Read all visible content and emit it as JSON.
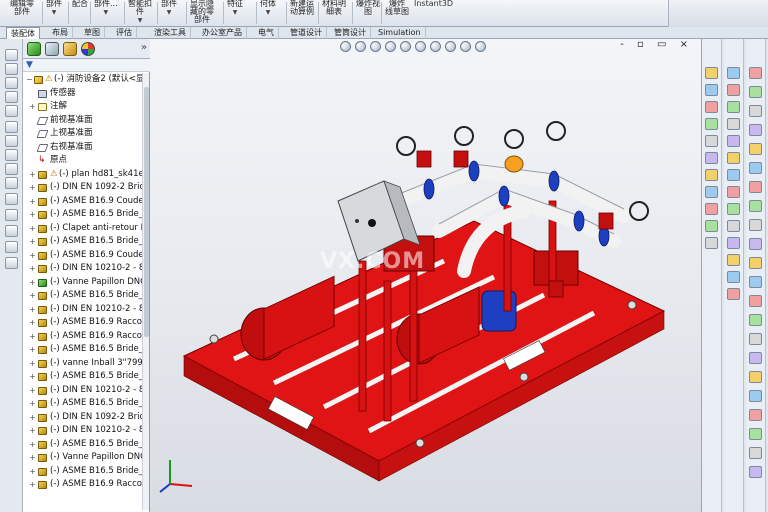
{
  "ribbon": {
    "buttons": [
      {
        "label": "编辑零\n部件",
        "has_dropdown": false
      },
      {
        "label": "部件",
        "has_dropdown": true
      },
      {
        "label": "配合",
        "has_dropdown": false
      },
      {
        "label": "部件...",
        "has_dropdown": true
      },
      {
        "label": "智能扣\n件",
        "has_dropdown": true
      },
      {
        "label": "部件",
        "has_dropdown": true
      },
      {
        "label": "显示隐\n藏的零\n部件",
        "has_dropdown": false
      },
      {
        "label": "特征",
        "has_dropdown": true
      },
      {
        "label": "何体",
        "has_dropdown": true
      },
      {
        "label": "新建运\n动算例",
        "has_dropdown": false
      },
      {
        "label": "材料明\n细表",
        "has_dropdown": false
      },
      {
        "label": "爆炸视\n图",
        "has_dropdown": false
      },
      {
        "label": "爆炸\n线草图",
        "has_dropdown": false
      }
    ],
    "instant3d": "Instant3D"
  },
  "tabs": [
    "装配体",
    "布局",
    "草图",
    "评估",
    "渲染工具",
    "办公室产品",
    "电气",
    "管道设计",
    "管筒设计",
    "Simulation"
  ],
  "active_tab": "装配体",
  "feature_tree": {
    "root": "(-) 消防设备2  (默认<显示状",
    "items": [
      {
        "label": "传感器",
        "icon": "sensor",
        "expandable": false
      },
      {
        "label": "注解",
        "icon": "note",
        "expandable": true
      },
      {
        "label": "前视基准面",
        "icon": "plane",
        "expandable": false
      },
      {
        "label": "上视基准面",
        "icon": "plane",
        "expandable": false
      },
      {
        "label": "右视基准面",
        "icon": "plane",
        "expandable": false
      },
      {
        "label": "原点",
        "icon": "origin",
        "expandable": false
      },
      {
        "label": "(-) plan hd81_sk41e",
        "icon": "part",
        "expandable": true,
        "warning": true
      },
      {
        "label": "(-) DIN EN 1092-2 Bric",
        "icon": "part",
        "expandable": true
      },
      {
        "label": "(-) ASME B16.9 Coude",
        "icon": "part",
        "expandable": true
      },
      {
        "label": "(-) ASME B16.5 Bride_",
        "icon": "part",
        "expandable": true
      },
      {
        "label": "(-) Clapet anti-retour D",
        "icon": "part",
        "expandable": true
      },
      {
        "label": "(-) ASME B16.5 Bride_",
        "icon": "part",
        "expandable": true
      },
      {
        "label": "(-) ASME B16.9 Coude",
        "icon": "part",
        "expandable": true
      },
      {
        "label": "(-) DIN EN 10210-2 - 8",
        "icon": "part",
        "expandable": true
      },
      {
        "label": "(-) Vanne Papillon DNC",
        "icon": "green",
        "expandable": true
      },
      {
        "label": "(-) ASME B16.5 Bride_",
        "icon": "part",
        "expandable": true
      },
      {
        "label": "(-) DIN EN 10210-2 - 8",
        "icon": "part",
        "expandable": true
      },
      {
        "label": "(-) ASME B16.9 Raccor",
        "icon": "part",
        "expandable": true
      },
      {
        "label": "(-) ASME B16.9 Raccor",
        "icon": "part",
        "expandable": true
      },
      {
        "label": "(-) ASME B16.5 Bride_",
        "icon": "part",
        "expandable": true
      },
      {
        "label": "(-) vanne Inball 3\"799[",
        "icon": "part",
        "expandable": true
      },
      {
        "label": "(-) ASME B16.5 Bride_",
        "icon": "part",
        "expandable": true
      },
      {
        "label": "(-) DIN EN 10210-2 - 8",
        "icon": "part",
        "expandable": true
      },
      {
        "label": "(-) ASME B16.5 Bride_",
        "icon": "part",
        "expandable": true
      },
      {
        "label": "(-) DIN EN 1092-2 Bric",
        "icon": "part",
        "expandable": true
      },
      {
        "label": "(-) DIN EN 10210-2 - 8",
        "icon": "part",
        "expandable": true
      },
      {
        "label": "(-) ASME B16.5 Bride_",
        "icon": "part",
        "expandable": true
      },
      {
        "label": "(-) Vanne Papillon DNC",
        "icon": "part",
        "expandable": true
      },
      {
        "label": "(-) ASME B16.5 Bride_",
        "icon": "part",
        "expandable": true
      },
      {
        "label": "(-) ASME B16.9 Raccor",
        "icon": "part",
        "expandable": true
      }
    ]
  },
  "viewport": {
    "watermark": "VX.COM",
    "window_controls": "- ▫ ▭ ×",
    "triad_axes": [
      "x",
      "y",
      "z"
    ]
  },
  "colors": {
    "frame_red": "#e01414",
    "pipe_white": "#f2f2f2",
    "flange_blue": "#1e3fbf",
    "valve_red": "#c40f0f",
    "accent_orange": "#f5a020"
  }
}
